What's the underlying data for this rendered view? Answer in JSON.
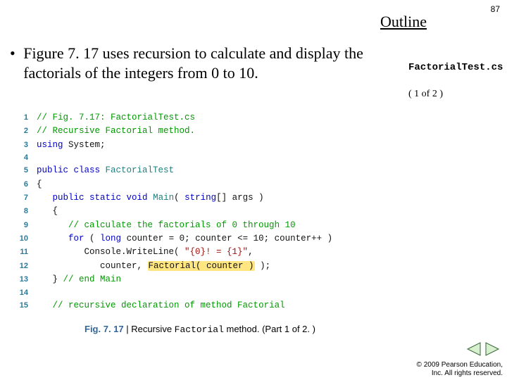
{
  "page_number": "87",
  "outline_heading": "Outline",
  "bullet_text": "Figure 7. 17 uses recursion to calculate and display the factorials of the integers from 0 to 10.",
  "file_label": "FactorialTest.cs",
  "part_label": "( 1 of 2 )",
  "code_lines": [
    {
      "n": "1",
      "tokens": [
        {
          "cls": "c-comment",
          "t": "// Fig. 7.17: FactorialTest.cs"
        }
      ]
    },
    {
      "n": "2",
      "tokens": [
        {
          "cls": "c-comment",
          "t": "// Recursive Factorial method."
        }
      ]
    },
    {
      "n": "3",
      "tokens": [
        {
          "cls": "c-kw",
          "t": "using"
        },
        {
          "cls": "c-plain",
          "t": " System;"
        }
      ]
    },
    {
      "n": "4",
      "tokens": []
    },
    {
      "n": "5",
      "tokens": [
        {
          "cls": "c-kw",
          "t": "public class"
        },
        {
          "cls": "c-plain",
          "t": " "
        },
        {
          "cls": "c-type",
          "t": "FactorialTest"
        }
      ]
    },
    {
      "n": "6",
      "tokens": [
        {
          "cls": "c-plain",
          "t": "{"
        }
      ]
    },
    {
      "n": "7",
      "tokens": [
        {
          "cls": "c-plain",
          "t": "   "
        },
        {
          "cls": "c-kw",
          "t": "public static void"
        },
        {
          "cls": "c-plain",
          "t": " "
        },
        {
          "cls": "c-type",
          "t": "Main"
        },
        {
          "cls": "c-plain",
          "t": "( "
        },
        {
          "cls": "c-kw",
          "t": "string"
        },
        {
          "cls": "c-plain",
          "t": "[] args )"
        }
      ]
    },
    {
      "n": "8",
      "tokens": [
        {
          "cls": "c-plain",
          "t": "   {"
        }
      ]
    },
    {
      "n": "9",
      "tokens": [
        {
          "cls": "c-plain",
          "t": "      "
        },
        {
          "cls": "c-comment",
          "t": "// calculate the factorials of 0 through 10"
        }
      ]
    },
    {
      "n": "10",
      "tokens": [
        {
          "cls": "c-plain",
          "t": "      "
        },
        {
          "cls": "c-kw",
          "t": "for"
        },
        {
          "cls": "c-plain",
          "t": " ( "
        },
        {
          "cls": "c-kw",
          "t": "long"
        },
        {
          "cls": "c-plain",
          "t": " counter = 0; counter <= 10; counter++ )"
        }
      ]
    },
    {
      "n": "11",
      "tokens": [
        {
          "cls": "c-plain",
          "t": "         Console.WriteLine( "
        },
        {
          "cls": "c-str",
          "t": "\"{0}! = {1}\""
        },
        {
          "cls": "c-plain",
          "t": ","
        }
      ]
    },
    {
      "n": "12",
      "tokens": [
        {
          "cls": "c-plain",
          "t": "            counter, "
        },
        {
          "cls": "c-plain hl",
          "t": "Factorial( counter )"
        },
        {
          "cls": "c-plain",
          "t": " );"
        }
      ]
    },
    {
      "n": "13",
      "tokens": [
        {
          "cls": "c-plain",
          "t": "   } "
        },
        {
          "cls": "c-comment",
          "t": "// end Main"
        }
      ]
    },
    {
      "n": "14",
      "tokens": []
    },
    {
      "n": "15",
      "tokens": [
        {
          "cls": "c-plain",
          "t": "   "
        },
        {
          "cls": "c-comment",
          "t": "// recursive declaration of method Factorial"
        }
      ]
    }
  ],
  "caption": {
    "fig": "Fig. 7. 17",
    "sep": " | ",
    "body_before": "Recursive ",
    "mono": "Factorial",
    "body_after": " method. (Part 1 of 2. )"
  },
  "copyright_line1": "© 2009 Pearson Education,",
  "copyright_line2": "Inc. All rights reserved."
}
